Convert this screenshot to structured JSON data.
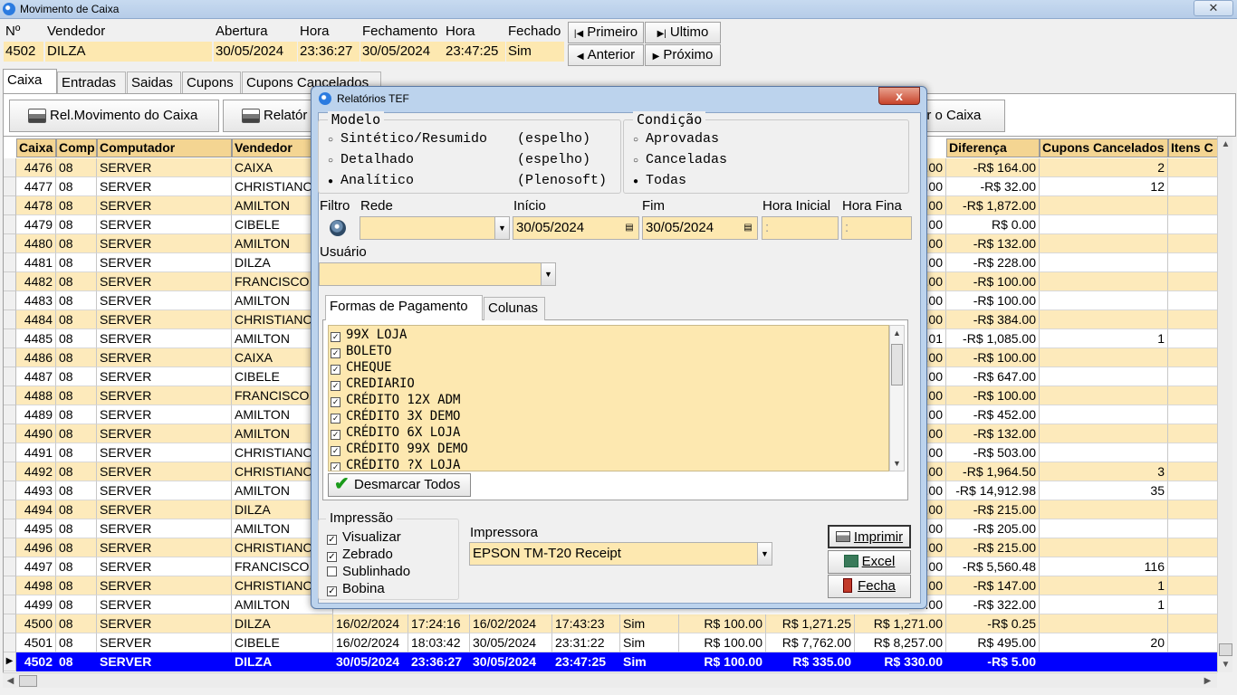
{
  "window": {
    "title": "Movimento de Caixa",
    "close_glyph": "✕"
  },
  "header": {
    "labels": {
      "num": "Nº",
      "vendedor": "Vendedor",
      "abertura": "Abertura",
      "hora": "Hora",
      "fechamento": "Fechamento",
      "hora2": "Hora",
      "fechado": "Fechado"
    },
    "values": {
      "num": "4502",
      "vendedor": "DILZA",
      "abertura": "30/05/2024",
      "hora": "23:36:27",
      "fechamento": "30/05/2024",
      "hora2": "23:47:25",
      "fechado": "Sim"
    }
  },
  "nav": {
    "primeiro": "Primeiro",
    "ultimo": "Ultimo",
    "anterior": "Anterior",
    "proximo": "Próximo"
  },
  "tabs": [
    "Caixa",
    "Entradas",
    "Saidas",
    "Cupons",
    "Cupons Cancelados"
  ],
  "toolbar": {
    "rel_movimento": "Rel.Movimento  do Caixa",
    "relatorio": "Relatór",
    "fechar_caixa": "ar o Caixa"
  },
  "grid": {
    "columns": [
      "Caixa",
      "Comp",
      "Computador",
      "Vendedor",
      "Diferença",
      "Cupons Cancelados",
      "Itens C"
    ],
    "rows": [
      {
        "caixa": "4476",
        "comp": "08",
        "computador": "SERVER",
        "vendedor": "CAIXA",
        "cut": ".00",
        "diferenca": "-R$ 164.00",
        "cupons": "2"
      },
      {
        "caixa": "4477",
        "comp": "08",
        "computador": "SERVER",
        "vendedor": "CHRISTIANO",
        "cut": ".00",
        "diferenca": "-R$ 32.00",
        "cupons": "12"
      },
      {
        "caixa": "4478",
        "comp": "08",
        "computador": "SERVER",
        "vendedor": "AMILTON",
        "cut": ".00",
        "diferenca": "-R$ 1,872.00",
        "cupons": ""
      },
      {
        "caixa": "4479",
        "comp": "08",
        "computador": "SERVER",
        "vendedor": "CIBELE",
        "cut": ".00",
        "diferenca": "R$ 0.00",
        "cupons": ""
      },
      {
        "caixa": "4480",
        "comp": "08",
        "computador": "SERVER",
        "vendedor": "AMILTON",
        "cut": ".00",
        "diferenca": "-R$ 132.00",
        "cupons": ""
      },
      {
        "caixa": "4481",
        "comp": "08",
        "computador": "SERVER",
        "vendedor": "DILZA",
        "cut": ".00",
        "diferenca": "-R$ 228.00",
        "cupons": ""
      },
      {
        "caixa": "4482",
        "comp": "08",
        "computador": "SERVER",
        "vendedor": "FRANCISCO",
        "cut": ".00",
        "diferenca": "-R$ 100.00",
        "cupons": ""
      },
      {
        "caixa": "4483",
        "comp": "08",
        "computador": "SERVER",
        "vendedor": "AMILTON",
        "cut": ".00",
        "diferenca": "-R$ 100.00",
        "cupons": ""
      },
      {
        "caixa": "4484",
        "comp": "08",
        "computador": "SERVER",
        "vendedor": "CHRISTIANO",
        "cut": ".00",
        "diferenca": "-R$ 384.00",
        "cupons": ""
      },
      {
        "caixa": "4485",
        "comp": "08",
        "computador": "SERVER",
        "vendedor": "AMILTON",
        "cut": ".01",
        "diferenca": "-R$ 1,085.00",
        "cupons": "1"
      },
      {
        "caixa": "4486",
        "comp": "08",
        "computador": "SERVER",
        "vendedor": "CAIXA",
        "cut": ".00",
        "diferenca": "-R$ 100.00",
        "cupons": ""
      },
      {
        "caixa": "4487",
        "comp": "08",
        "computador": "SERVER",
        "vendedor": "CIBELE",
        "cut": ".00",
        "diferenca": "-R$ 647.00",
        "cupons": ""
      },
      {
        "caixa": "4488",
        "comp": "08",
        "computador": "SERVER",
        "vendedor": "FRANCISCO",
        "cut": ".00",
        "diferenca": "-R$ 100.00",
        "cupons": ""
      },
      {
        "caixa": "4489",
        "comp": "08",
        "computador": "SERVER",
        "vendedor": "AMILTON",
        "cut": ".00",
        "diferenca": "-R$ 452.00",
        "cupons": ""
      },
      {
        "caixa": "4490",
        "comp": "08",
        "computador": "SERVER",
        "vendedor": "AMILTON",
        "cut": ".00",
        "diferenca": "-R$ 132.00",
        "cupons": ""
      },
      {
        "caixa": "4491",
        "comp": "08",
        "computador": "SERVER",
        "vendedor": "CHRISTIANO",
        "cut": ".00",
        "diferenca": "-R$ 503.00",
        "cupons": ""
      },
      {
        "caixa": "4492",
        "comp": "08",
        "computador": "SERVER",
        "vendedor": "CHRISTIANO",
        "cut": ".00",
        "diferenca": "-R$ 1,964.50",
        "cupons": "3"
      },
      {
        "caixa": "4493",
        "comp": "08",
        "computador": "SERVER",
        "vendedor": "AMILTON",
        "cut": ".00",
        "diferenca": "-R$ 14,912.98",
        "cupons": "35"
      },
      {
        "caixa": "4494",
        "comp": "08",
        "computador": "SERVER",
        "vendedor": "DILZA",
        "cut": ".00",
        "diferenca": "-R$ 215.00",
        "cupons": ""
      },
      {
        "caixa": "4495",
        "comp": "08",
        "computador": "SERVER",
        "vendedor": "AMILTON",
        "cut": ".00",
        "diferenca": "-R$ 205.00",
        "cupons": ""
      },
      {
        "caixa": "4496",
        "comp": "08",
        "computador": "SERVER",
        "vendedor": "CHRISTIANO",
        "cut": ".00",
        "diferenca": "-R$ 215.00",
        "cupons": ""
      },
      {
        "caixa": "4497",
        "comp": "08",
        "computador": "SERVER",
        "vendedor": "FRANCISCO",
        "cut": ".00",
        "diferenca": "-R$ 5,560.48",
        "cupons": "116"
      },
      {
        "caixa": "4498",
        "comp": "08",
        "computador": "SERVER",
        "vendedor": "CHRISTIANO",
        "cut": ".00",
        "diferenca": "-R$ 147.00",
        "cupons": "1"
      },
      {
        "caixa": "4499",
        "comp": "08",
        "computador": "SERVER",
        "vendedor": "AMILTON",
        "cut": ".00",
        "diferenca": "-R$ 322.00",
        "cupons": "1"
      }
    ],
    "full_rows": [
      {
        "caixa": "4500",
        "comp": "08",
        "computador": "SERVER",
        "vendedor": "DILZA",
        "abertura": "16/02/2024",
        "hora": "17:24:16",
        "fechamento": "16/02/2024",
        "hora2": "17:43:23",
        "fechado": "Sim",
        "v1": "R$ 100.00",
        "v2": "R$ 1,271.25",
        "v3": "R$ 1,271.00",
        "diferenca": "-R$ 0.25",
        "cupons": ""
      },
      {
        "caixa": "4501",
        "comp": "08",
        "computador": "SERVER",
        "vendedor": "CIBELE",
        "abertura": "16/02/2024",
        "hora": "18:03:42",
        "fechamento": "30/05/2024",
        "hora2": "23:31:22",
        "fechado": "Sim",
        "v1": "R$ 100.00",
        "v2": "R$ 7,762.00",
        "v3": "R$ 8,257.00",
        "diferenca": "R$ 495.00",
        "cupons": "20"
      },
      {
        "caixa": "4502",
        "comp": "08",
        "computador": "SERVER",
        "vendedor": "DILZA",
        "abertura": "30/05/2024",
        "hora": "23:36:27",
        "fechamento": "30/05/2024",
        "hora2": "23:47:25",
        "fechado": "Sim",
        "v1": "R$ 100.00",
        "v2": "R$ 335.00",
        "v3": "R$ 330.00",
        "diferenca": "-R$ 5.00",
        "cupons": ""
      }
    ]
  },
  "dialog": {
    "title": "Relatórios TEF",
    "close_glyph": "x",
    "modelo": {
      "legend": "Modelo",
      "options": [
        {
          "label": "Sintético/Resumido",
          "note": "(espelho)",
          "selected": false
        },
        {
          "label": "Detalhado",
          "note": "(espelho)",
          "selected": false
        },
        {
          "label": "Analítico",
          "note": "(Plenosoft)",
          "selected": true
        }
      ]
    },
    "condicao": {
      "legend": "Condição",
      "options": [
        {
          "label": "Aprovadas",
          "selected": false
        },
        {
          "label": "Canceladas",
          "selected": false
        },
        {
          "label": "Todas",
          "selected": true
        }
      ]
    },
    "filtro_label": "Filtro",
    "rede_label": "Rede",
    "rede_value": "",
    "inicio_label": "Início",
    "inicio_value": "30/05/2024",
    "fim_label": "Fim",
    "fim_value": "30/05/2024",
    "hora_inicial_label": "Hora Inicial",
    "hora_inicial_value": ":",
    "hora_final_label": "Hora Fina",
    "hora_final_value": ":",
    "usuario_label": "Usuário",
    "usuario_value": "",
    "inner_tabs": [
      "Formas de Pagamento",
      "Colunas"
    ],
    "formas": [
      "99X LOJA",
      "BOLETO",
      "CHEQUE",
      "CREDIARIO",
      "CRÉDITO 12X ADM",
      "CRÉDITO 3X DEMO",
      "CRÉDITO 6X LOJA",
      "CRÉDITO 99X DEMO",
      "CRÉDITO ?X LOJA"
    ],
    "desmarcar": "Desmarcar Todos",
    "impressao": {
      "legend": "Impressão",
      "options": [
        {
          "label": "Visualizar",
          "checked": true
        },
        {
          "label": "Zebrado",
          "checked": true
        },
        {
          "label": "Sublinhado",
          "checked": false
        },
        {
          "label": "Bobina",
          "checked": true
        }
      ]
    },
    "impressora_label": "Impressora",
    "impressora_value": "EPSON TM-T20 Receipt",
    "buttons": {
      "imprimir": "Imprimir",
      "excel": "Excel",
      "fecha": "Fecha"
    }
  },
  "colors": {
    "highlight": "#fde8b0",
    "selection": "#0000ff",
    "header": "#f4d592"
  }
}
